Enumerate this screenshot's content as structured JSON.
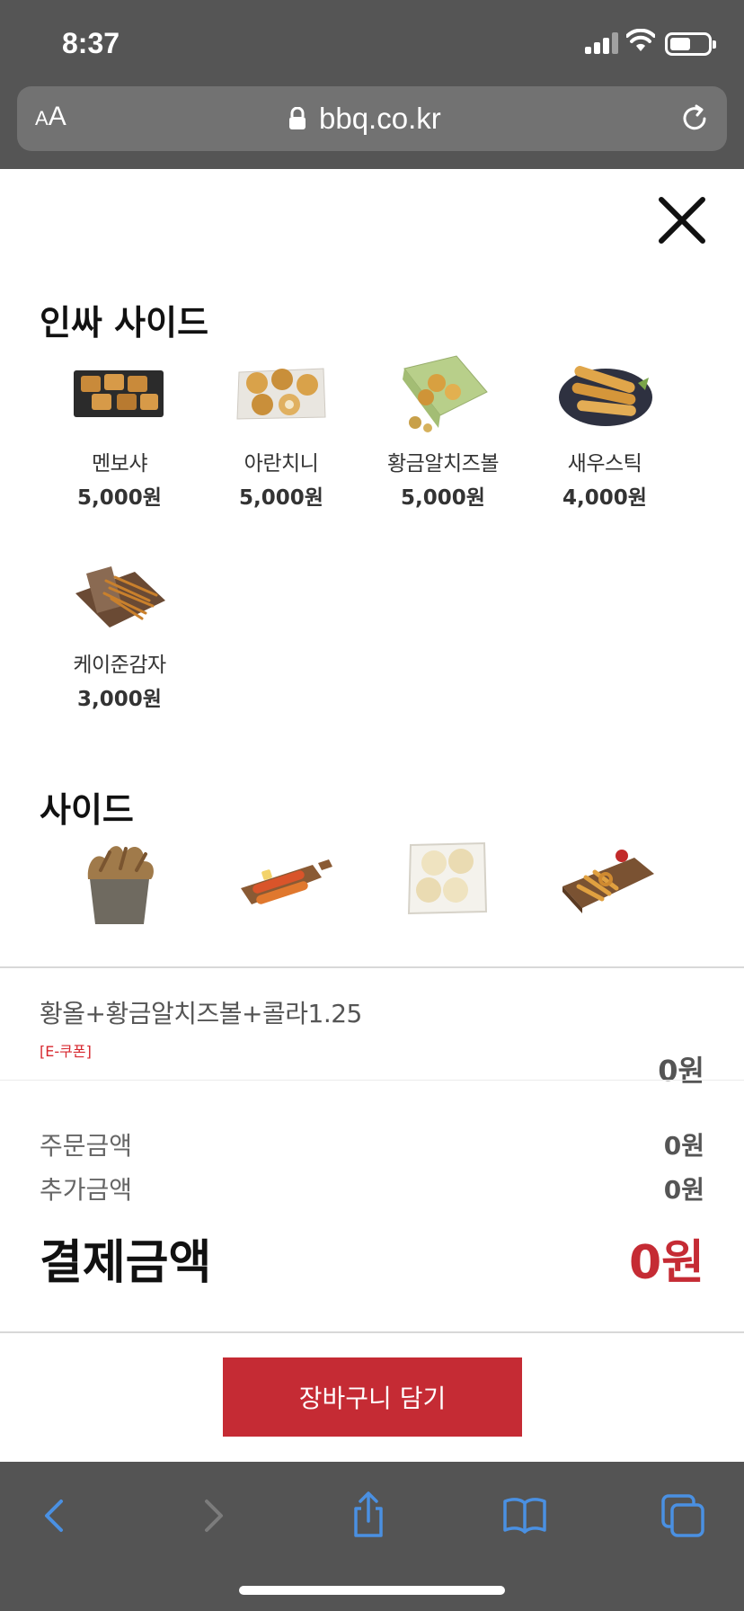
{
  "status_bar": {
    "time": "8:37"
  },
  "browser": {
    "text_size_small": "A",
    "text_size_big": "A",
    "url": "bbq.co.kr"
  },
  "sections": [
    {
      "title": "인싸 사이드",
      "items": [
        {
          "name": "멘보샤",
          "price": "5,000원"
        },
        {
          "name": "아란치니",
          "price": "5,000원"
        },
        {
          "name": "황금알치즈볼",
          "price": "5,000원"
        },
        {
          "name": "새우스틱",
          "price": "4,000원"
        },
        {
          "name": "케이준감자",
          "price": "3,000원"
        }
      ]
    },
    {
      "title": "사이드"
    }
  ],
  "selected": {
    "name": "황올+황금알치즈볼+콜라1.25",
    "coupon": "[E-쿠폰]",
    "price": "0원"
  },
  "summary": {
    "order_label": "주문금액",
    "order_value": "0원",
    "extra_label": "추가금액",
    "extra_value": "0원",
    "total_label": "결제금액",
    "total_value": "0원"
  },
  "cart_button": "장바구니 담기",
  "colors": {
    "accent": "#c52b34",
    "browser_chrome": "#555555",
    "toolbar_icon": "#4a90e2"
  }
}
